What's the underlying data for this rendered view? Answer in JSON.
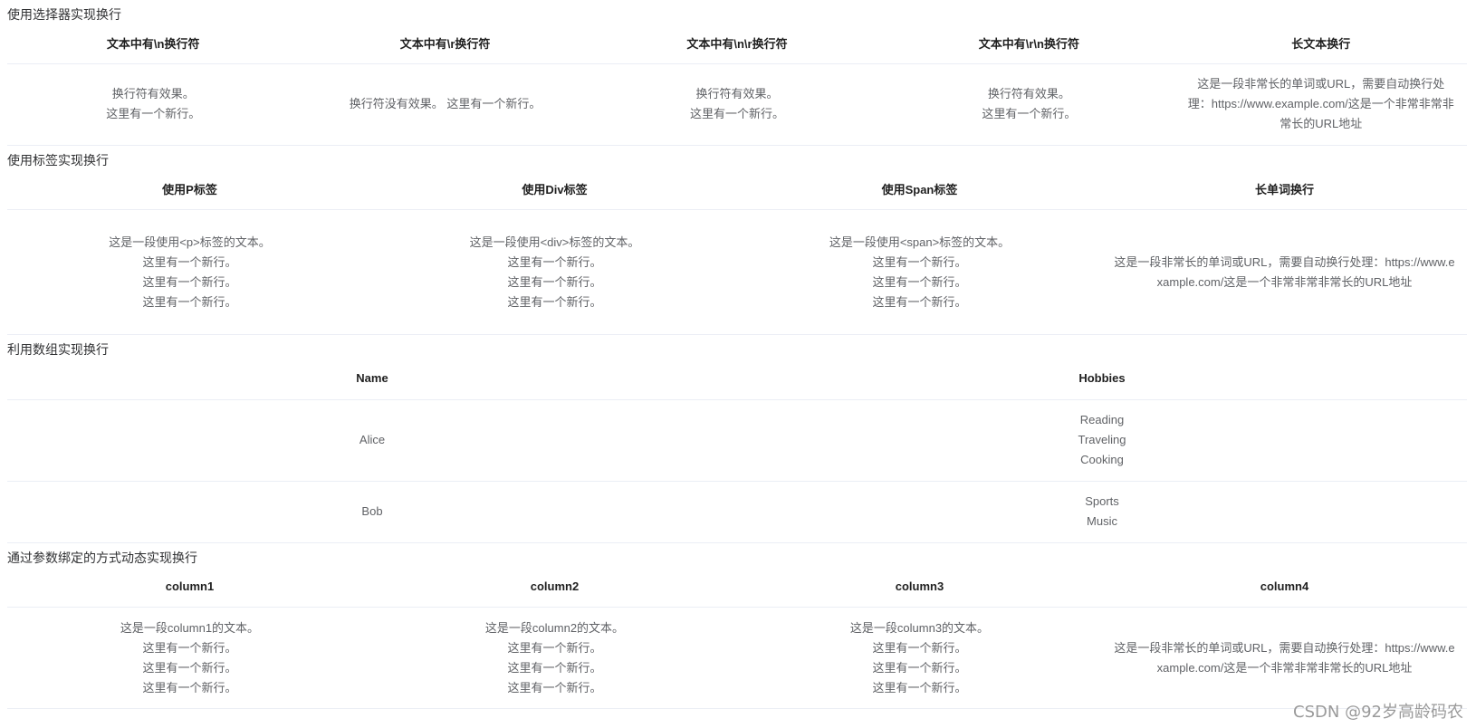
{
  "sections": {
    "selector": {
      "title": "使用选择器实现换行",
      "headers": [
        "文本中有\\n换行符",
        "文本中有\\r换行符",
        "文本中有\\n\\r换行符",
        "文本中有\\r\\n换行符",
        "长文本换行"
      ],
      "cells": [
        [
          "换行符有效果。",
          "这里有一个新行。"
        ],
        [
          "换行符没有效果。 这里有一个新行。"
        ],
        [
          "换行符有效果。",
          "这里有一个新行。"
        ],
        [
          "换行符有效果。",
          "这里有一个新行。"
        ],
        [
          "这是一段非常长的单词或URL，需要自动换行处理：https://www.example.com/这是一个非常非常非常长的URL地址"
        ]
      ]
    },
    "tags": {
      "title": "使用标签实现换行",
      "headers": [
        "使用P标签",
        "使用Div标签",
        "使用Span标签",
        "长单词换行"
      ],
      "cells": [
        [
          "这是一段使用<p>标签的文本。",
          "这里有一个新行。",
          "这里有一个新行。",
          "这里有一个新行。"
        ],
        [
          "这是一段使用<div>标签的文本。",
          "这里有一个新行。",
          "这里有一个新行。",
          "这里有一个新行。"
        ],
        [
          "这是一段使用<span>标签的文本。",
          "这里有一个新行。",
          "这里有一个新行。",
          "这里有一个新行。"
        ],
        [
          "这是一段非常长的单词或URL，需要自动换行处理：https://www.example.com/这是一个非常非常非常长的URL地址"
        ]
      ]
    },
    "array": {
      "title": "利用数组实现换行",
      "headers": [
        "Name",
        "Hobbies"
      ],
      "rows": [
        {
          "name": "Alice",
          "hobbies": [
            "Reading",
            "Traveling",
            "Cooking"
          ]
        },
        {
          "name": "Bob",
          "hobbies": [
            "Sports",
            "Music"
          ]
        }
      ]
    },
    "binding": {
      "title": "通过参数绑定的方式动态实现换行",
      "headers": [
        "column1",
        "column2",
        "column3",
        "column4"
      ],
      "cells": [
        [
          "这是一段column1的文本。",
          "这里有一个新行。",
          "这里有一个新行。",
          "这里有一个新行。"
        ],
        [
          "这是一段column2的文本。",
          "这里有一个新行。",
          "这里有一个新行。",
          "这里有一个新行。"
        ],
        [
          "这是一段column3的文本。",
          "这里有一个新行。",
          "这里有一个新行。",
          "这里有一个新行。"
        ],
        [
          "这是一段非常长的单词或URL，需要自动换行处理：https://www.example.com/这是一个非常非常非常长的URL地址"
        ]
      ]
    }
  },
  "watermark": "CSDN @92岁高龄码农"
}
